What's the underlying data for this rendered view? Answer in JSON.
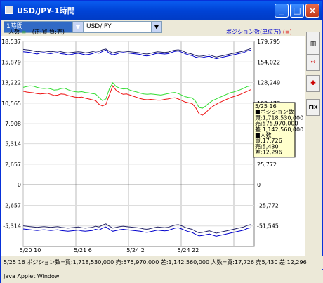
{
  "window": {
    "title": "USD/JPY-1時間",
    "minimize_label": "_",
    "maximize_label": "□",
    "close_label": "×"
  },
  "toolbar": {
    "period_select": "1時間",
    "pair_select": "USD/JPY"
  },
  "legend": {
    "left": "人数",
    "left_sym": "(",
    "left_sym_val": "≡",
    "left_sym_end": ")",
    "mid": "(正:買",
    "mid2": "負:売)",
    "right": "ポジション数(単位万)",
    "right_sym": "(≡)"
  },
  "colors": {
    "buy_green": "#33dd33",
    "sell_red": "#ee1111",
    "count_blue": "#0000cc",
    "count_dark": "#222266",
    "axis_blue": "#0000cc"
  },
  "chart_data": {
    "type": "line",
    "x_labels": [
      "5/20 10",
      "5/21 6",
      "5/24 2",
      "5/24 22"
    ],
    "left_axis_ticks": [
      "18,537",
      "15,879",
      "13,222",
      "10,565",
      "7,908",
      "5,314",
      "2,657",
      "0",
      "-2,657",
      "-5,314"
    ],
    "right_axis_ticks": [
      "179,795",
      "154,022",
      "128,249",
      "102,477",
      "76,704",
      "51,931",
      "25,772",
      "0",
      "-25,772",
      "-51,545"
    ],
    "ylim_left": [
      -7971,
      18537
    ],
    "series": [
      {
        "id": "buy_count_blue",
        "values": [
          17200,
          17150,
          17100,
          17000,
          16900,
          17050,
          17100,
          17000,
          16950,
          17050,
          17100,
          16950,
          16900,
          16800,
          16850,
          16950,
          17000,
          16900,
          16800,
          16850,
          16950,
          17100,
          17000,
          17250,
          17400,
          17000,
          16800,
          16900,
          17050,
          17100,
          17050,
          17000,
          16950,
          16900,
          16850,
          16700,
          16650,
          16750,
          16900,
          17000,
          16950,
          16900,
          16950,
          17100,
          17250,
          17300,
          17150,
          16950,
          16800,
          16700,
          16500,
          16400,
          16450,
          16550,
          16600,
          16450,
          16300,
          16400,
          16500,
          16600,
          16700,
          16800,
          16900,
          17000,
          17100,
          17300,
          17400
        ]
      },
      {
        "id": "buy_count_dark",
        "values": [
          17500,
          17450,
          17400,
          17300,
          17200,
          17250,
          17300,
          17250,
          17200,
          17250,
          17300,
          17200,
          17100,
          17050,
          17100,
          17150,
          17200,
          17150,
          17050,
          17100,
          17200,
          17300,
          17250,
          17450,
          17550,
          17250,
          17050,
          17150,
          17250,
          17300,
          17250,
          17200,
          17150,
          17100,
          17050,
          16950,
          16900,
          17000,
          17100,
          17200,
          17150,
          17100,
          17150,
          17300,
          17400,
          17450,
          17350,
          17150,
          17000,
          16900,
          16700,
          16600,
          16650,
          16750,
          16800,
          16650,
          16500,
          16600,
          16700,
          16800,
          16900,
          17000,
          17100,
          17200,
          17300,
          17450,
          17600
        ]
      },
      {
        "id": "buy_green",
        "values": [
          12600,
          12700,
          12800,
          12750,
          12600,
          12500,
          12450,
          12500,
          12400,
          12250,
          12300,
          12450,
          12500,
          12300,
          12150,
          12050,
          12000,
          12050,
          11950,
          11900,
          11800,
          11750,
          11300,
          10900,
          11100,
          12400,
          13200,
          12700,
          12500,
          12400,
          12450,
          12250,
          12100,
          12000,
          11850,
          11750,
          11700,
          11750,
          11700,
          11650,
          11600,
          11700,
          11800,
          11900,
          11950,
          11800,
          11600,
          11400,
          11300,
          11250,
          10800,
          10000,
          9900,
          10200,
          10600,
          10900,
          11100,
          11300,
          11500,
          11700,
          11900,
          12000,
          12150,
          12300,
          12500,
          12700,
          12800
        ]
      },
      {
        "id": "sell_red",
        "values": [
          12100,
          12000,
          11950,
          11900,
          11800,
          11750,
          11800,
          11850,
          11700,
          11550,
          11600,
          11750,
          11700,
          11550,
          11450,
          11350,
          11300,
          11350,
          11200,
          11100,
          11000,
          10900,
          10400,
          10200,
          10400,
          11600,
          12800,
          12200,
          11900,
          11700,
          11750,
          11600,
          11450,
          11300,
          11150,
          11050,
          11000,
          11050,
          11000,
          10950,
          10950,
          11050,
          11100,
          11200,
          11250,
          11100,
          10900,
          10700,
          10600,
          10500,
          10000,
          9200,
          9000,
          9350,
          9800,
          10150,
          10400,
          10650,
          10850,
          11050,
          11250,
          11400,
          11550,
          11700,
          11900,
          12100,
          12300
        ]
      },
      {
        "id": "sell_count_blue",
        "values": [
          -5700,
          -5750,
          -5800,
          -5850,
          -5900,
          -5850,
          -5800,
          -5850,
          -5900,
          -5850,
          -5800,
          -5900,
          -5950,
          -6000,
          -5950,
          -5900,
          -5850,
          -5950,
          -6000,
          -5950,
          -5900,
          -5750,
          -5850,
          -5600,
          -5450,
          -5750,
          -6000,
          -5900,
          -5800,
          -5750,
          -5800,
          -5850,
          -5900,
          -5950,
          -6000,
          -6100,
          -6150,
          -6050,
          -5950,
          -5850,
          -5900,
          -5950,
          -5900,
          -5750,
          -5600,
          -5550,
          -5700,
          -5900,
          -6050,
          -6150,
          -6400,
          -6600,
          -6550,
          -6450,
          -6350,
          -6500,
          -6650,
          -6550,
          -6450,
          -6350,
          -6250,
          -6150,
          -6050,
          -5950,
          -5850,
          -5650,
          -5550
        ]
      },
      {
        "id": "sell_count_dark",
        "values": [
          -5300,
          -5350,
          -5400,
          -5450,
          -5500,
          -5450,
          -5400,
          -5450,
          -5500,
          -5450,
          -5400,
          -5500,
          -5550,
          -5600,
          -5550,
          -5500,
          -5450,
          -5550,
          -5600,
          -5550,
          -5500,
          -5350,
          -5450,
          -5200,
          -5050,
          -5350,
          -5600,
          -5500,
          -5400,
          -5350,
          -5400,
          -5450,
          -5500,
          -5550,
          -5600,
          -5700,
          -5750,
          -5650,
          -5550,
          -5450,
          -5500,
          -5550,
          -5500,
          -5350,
          -5200,
          -5150,
          -5300,
          -5500,
          -5650,
          -5750,
          -6000,
          -6200,
          -6150,
          -6050,
          -5950,
          -6100,
          -6250,
          -6150,
          -6050,
          -5950,
          -5850,
          -5750,
          -5650,
          -5550,
          -5450,
          -5250,
          -5150
        ]
      }
    ]
  },
  "tooltip": {
    "lines": [
      "5/25 16",
      "■ポジション数",
      "買:1,718,530,000",
      "売:575,970,000",
      "差:1,142,560,000",
      "■人数",
      "買:17,726",
      "売:5,430",
      "差:12,296"
    ]
  },
  "sidebar": {
    "btn1": "▥",
    "btn2": "↔",
    "btn3": "✚",
    "btn4": "FIX"
  },
  "status": {
    "text": "5/25 16 ポジション数=買:1,718,530,000 売:575,970,000 差:1,142,560,000 人数=買:17,726 売5,430 差:12,296"
  },
  "footer": {
    "text": "Java Applet Window"
  }
}
